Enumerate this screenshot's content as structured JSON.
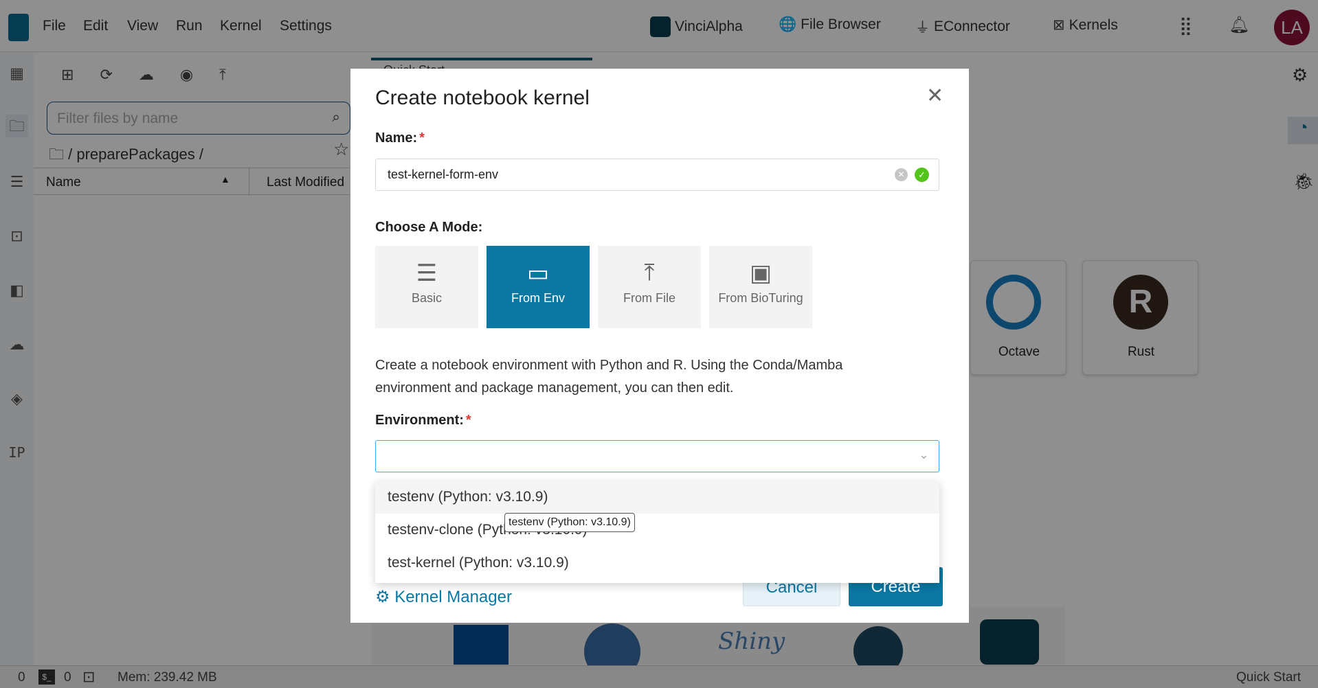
{
  "menu": [
    "File",
    "Edit",
    "View",
    "Run",
    "Kernel",
    "Settings"
  ],
  "topnav": [
    {
      "label": "VinciAlpha",
      "icon": "vincialpha-logo-icon"
    },
    {
      "label": "File Browser",
      "icon": "file-globe-icon"
    },
    {
      "label": "EConnector",
      "icon": "plug-icon"
    },
    {
      "label": "Kernels",
      "icon": "chip-icon"
    }
  ],
  "avatar": "LA",
  "files": {
    "filter_placeholder": "Filter files by name",
    "breadcrumb": "/ preparePackages /",
    "col_name": "Name",
    "col_modified": "Last Modified"
  },
  "rail_text": "IP",
  "tab": "Quick Start",
  "launcher": [
    "Octave",
    "Rust"
  ],
  "status": {
    "left_count": "0",
    "terminal_count": "0",
    "mem": "Mem: 239.42 MB",
    "right": "Quick Start"
  },
  "modal": {
    "title": "Create notebook kernel",
    "name_label": "Name:",
    "name_value": "test-kernel-form-env",
    "mode_label": "Choose A Mode:",
    "modes": [
      "Basic",
      "From Env",
      "From File",
      "From BioTuring"
    ],
    "active_mode": "From Env",
    "description": "Create a notebook environment with Python and R. Using the Conda/Mamba environment and package management, you can then edit.",
    "env_label": "Environment:",
    "env_value": "",
    "options": [
      "testenv (Python: v3.10.9)",
      "testenv-clone (Python: v3.10.9)",
      "test-kernel (Python: v3.10.9)"
    ],
    "tooltip": "testenv (Python: v3.10.9)",
    "kernel_manager": "Kernel Manager",
    "cancel": "Cancel",
    "create": "Create"
  },
  "colors": {
    "accent": "#0b77a3",
    "avatar": "#8b1538",
    "valid": "#52c41a",
    "required": "#e53935"
  }
}
